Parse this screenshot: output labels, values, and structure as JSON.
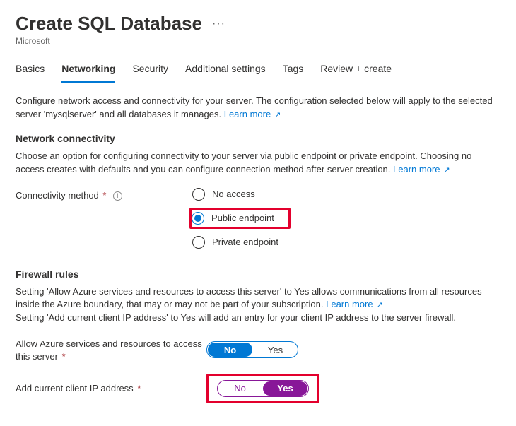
{
  "header": {
    "title": "Create SQL Database",
    "subtitle": "Microsoft"
  },
  "tabs": {
    "items": [
      {
        "label": "Basics"
      },
      {
        "label": "Networking"
      },
      {
        "label": "Security"
      },
      {
        "label": "Additional settings"
      },
      {
        "label": "Tags"
      },
      {
        "label": "Review + create"
      }
    ],
    "activeIndex": 1
  },
  "intro": {
    "text": "Configure network access and connectivity for your server. The configuration selected below will apply to the selected server 'mysqlserver' and all databases it manages. ",
    "learn_more": "Learn more"
  },
  "network": {
    "title": "Network connectivity",
    "desc": "Choose an option for configuring connectivity to your server via public endpoint or private endpoint. Choosing no access creates with defaults and you can configure connection method after server creation. ",
    "learn_more": "Learn more",
    "method_label": "Connectivity method",
    "options": {
      "none": "No access",
      "public": "Public endpoint",
      "private": "Private endpoint"
    },
    "selected": "public"
  },
  "firewall": {
    "title": "Firewall rules",
    "desc1a": "Setting 'Allow Azure services and resources to access this server' to Yes allows communications from all resources inside the Azure boundary, that may or may not be part of your subscription. ",
    "learn_more": "Learn more",
    "desc2": "Setting 'Add current client IP address' to Yes will add an entry for your client IP address to the server firewall.",
    "allow_label": "Allow Azure services and resources to access this server",
    "addip_label": "Add current client IP address",
    "no": "No",
    "yes": "Yes",
    "allow_value": "No",
    "addip_value": "Yes"
  }
}
